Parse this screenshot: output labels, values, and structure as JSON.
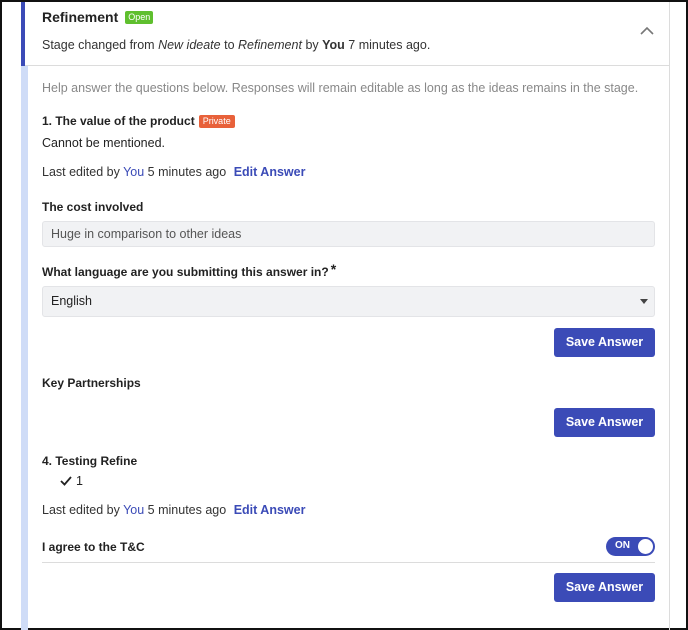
{
  "header": {
    "stage_title": "Refinement",
    "status_badge": "Open",
    "change_prefix": "Stage changed from",
    "from_stage": "New ideate",
    "to_word": "to",
    "to_stage": "Refinement",
    "by_word": "by",
    "actor": "You",
    "time_ago": "7 minutes ago."
  },
  "help_text": "Help answer the questions below. Responses will remain editable as long as the ideas remains in the stage.",
  "questions": {
    "value": {
      "label": "1. The value of the product",
      "badge": "Private",
      "answer": "Cannot be mentioned.",
      "edited_prefix": "Last edited by",
      "edited_by": "You",
      "edited_time": "5 minutes ago",
      "edit_link": "Edit Answer"
    },
    "cost": {
      "label": "The cost involved",
      "value": "Huge in comparison to other ideas"
    },
    "language": {
      "label": "What language are you submitting this answer in?",
      "required_mark": "*",
      "selected": "English",
      "save_label": "Save Answer"
    },
    "partnerships": {
      "label": "Key Partnerships",
      "save_label": "Save Answer"
    },
    "testing": {
      "label": "4. Testing Refine",
      "checked_value": "1",
      "edited_prefix": "Last edited by",
      "edited_by": "You",
      "edited_time": "5 minutes ago",
      "edit_link": "Edit Answer"
    },
    "terms": {
      "label": "I agree to the T&C",
      "toggle_state": "ON",
      "save_label": "Save Answer"
    }
  },
  "colors": {
    "accent": "#3b4bb7",
    "open_badge": "#5fbf2e",
    "private_badge": "#e8613a",
    "side_rail": "#cfdcf7"
  }
}
